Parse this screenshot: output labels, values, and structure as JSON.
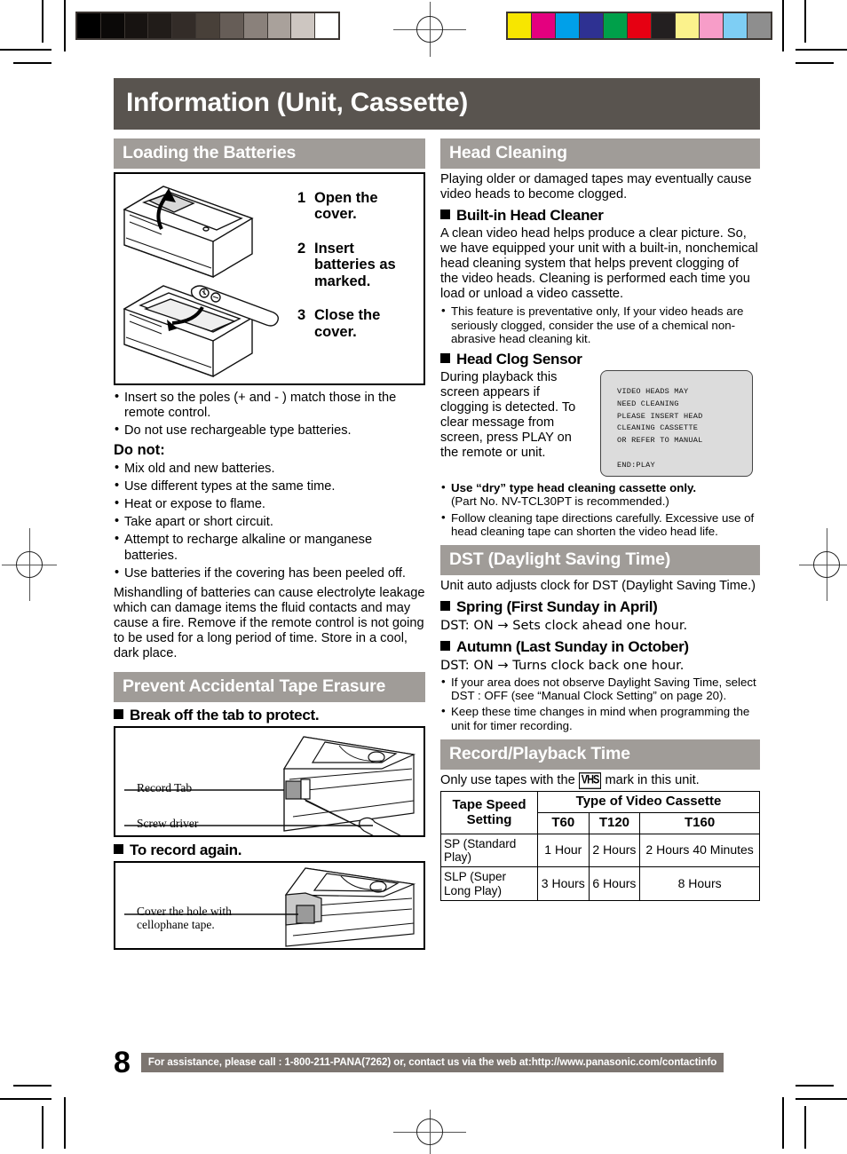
{
  "page_title": "Information (Unit, Cassette)",
  "page_number": "8",
  "footer_note": "For assistance, please call : 1-800-211-PANA(7262) or, contact us via the web at:http://www.panasonic.com/contactinfo",
  "colors": {
    "title_bar": "#59544f",
    "section_header": "#a09c98",
    "footer_bar": "#7c7570",
    "osd_background": "#dcdcdc"
  },
  "grayscale_strip": [
    "#000000",
    "#0b0908",
    "#171311",
    "#211c19",
    "#332c28",
    "#484039",
    "#665d57",
    "#8a817b",
    "#a9a19b",
    "#cdc6c1",
    "#ffffff"
  ],
  "color_strip": [
    "#f7e600",
    "#e4007f",
    "#00a0e9",
    "#2e3192",
    "#00a04a",
    "#e60012",
    "#231f20",
    "#fbf28c",
    "#f79dc8",
    "#7ecef4",
    "#8e8e8e"
  ],
  "sections": {
    "loading_batteries": {
      "header": "Loading the Batteries",
      "figure": {
        "name": "remote-battery-cover-diagram",
        "steps": [
          {
            "num": "1",
            "text": "Open the cover."
          },
          {
            "num": "2",
            "text": "Insert batteries as marked."
          },
          {
            "num": "3",
            "text": "Close the cover."
          }
        ]
      },
      "bullets": [
        "Insert so the poles (+ and - ) match those in the remote control.",
        "Do not use rechargeable type batteries."
      ],
      "do_not_label": "Do not:",
      "do_not_bullets": [
        "Mix old and new batteries.",
        "Use different types at the same time.",
        "Heat or expose to flame.",
        "Take apart or short circuit.",
        "Attempt to recharge alkaline or manganese batteries.",
        "Use batteries if the covering has been peeled off."
      ],
      "warning": "Mishandling of batteries can cause electrolyte leakage which can damage items the fluid contacts and may cause a fire. Remove if the remote control is not going to be used for a long period of time. Store in a cool, dark place."
    },
    "prevent_erasure": {
      "header": "Prevent Accidental Tape Erasure",
      "sub1": "Break off the tab to protect.",
      "fig1_labels": [
        "Record Tab",
        "Screw driver"
      ],
      "sub2": "To record again.",
      "fig2_label_line1": "Cover the hole with",
      "fig2_label_line2": "cellophane tape."
    },
    "head_cleaning": {
      "header": "Head Cleaning",
      "intro": "Playing older or damaged tapes may eventually cause video heads to become clogged.",
      "sub1": "Built-in Head Cleaner",
      "body1": "A clean video head helps produce a clear picture. So, we have equipped your unit with a built-in, nonchemical head cleaning system that helps prevent clogging of the video heads. Cleaning is performed each time you load or unload a video cassette.",
      "bullet1": "This feature is preventative only, If your video heads are seriously clogged, consider the use of a chemical non-abrasive head cleaning kit.",
      "sub2": "Head Clog Sensor",
      "body2": "During playback this screen appears if clogging is detected. To clear message from screen, press PLAY on the remote or unit.",
      "osd_lines": [
        "VIDEO HEADS MAY",
        "NEED CLEANING",
        "PLEASE INSERT HEAD",
        "CLEANING CASSETTE",
        "OR REFER TO MANUAL",
        "",
        "END:PLAY"
      ],
      "bullet2_bold": "Use “dry” type head cleaning cassette only.",
      "bullet2_rest": "(Part No. NV-TCL30PT is recommended.)",
      "bullet3": "Follow cleaning tape directions carefully. Excessive use of head cleaning tape can shorten the video head life."
    },
    "dst": {
      "header": "DST (Daylight Saving Time)",
      "intro": "Unit auto adjusts clock for DST (Daylight Saving Time.)",
      "sub1": "Spring (First Sunday in April)",
      "line1": "DST: ON → Sets clock ahead one hour.",
      "sub2": "Autumn (Last Sunday in October)",
      "line2": "DST: ON → Turns clock back one hour.",
      "bullets": [
        "If your area does not observe Daylight Saving Time, select DST : OFF (see “Manual Clock Setting” on page 20).",
        "Keep these time changes in mind when programming the unit for timer recording."
      ]
    },
    "record_playback": {
      "header": "Record/Playback Time",
      "intro_before": "Only use tapes with the",
      "vhs_mark": "VHS",
      "intro_after": "mark in this unit.",
      "table": {
        "row_header": "Tape Speed Setting",
        "col_group_header": "Type of Video Cassette",
        "columns": [
          "T60",
          "T120",
          "T160"
        ],
        "rows": [
          {
            "label": "SP (Standard Play)",
            "values": [
              "1 Hour",
              "2 Hours",
              "2 Hours 40 Minutes"
            ]
          },
          {
            "label": "SLP (Super Long Play)",
            "values": [
              "3 Hours",
              "6 Hours",
              "8 Hours"
            ]
          }
        ]
      }
    }
  }
}
